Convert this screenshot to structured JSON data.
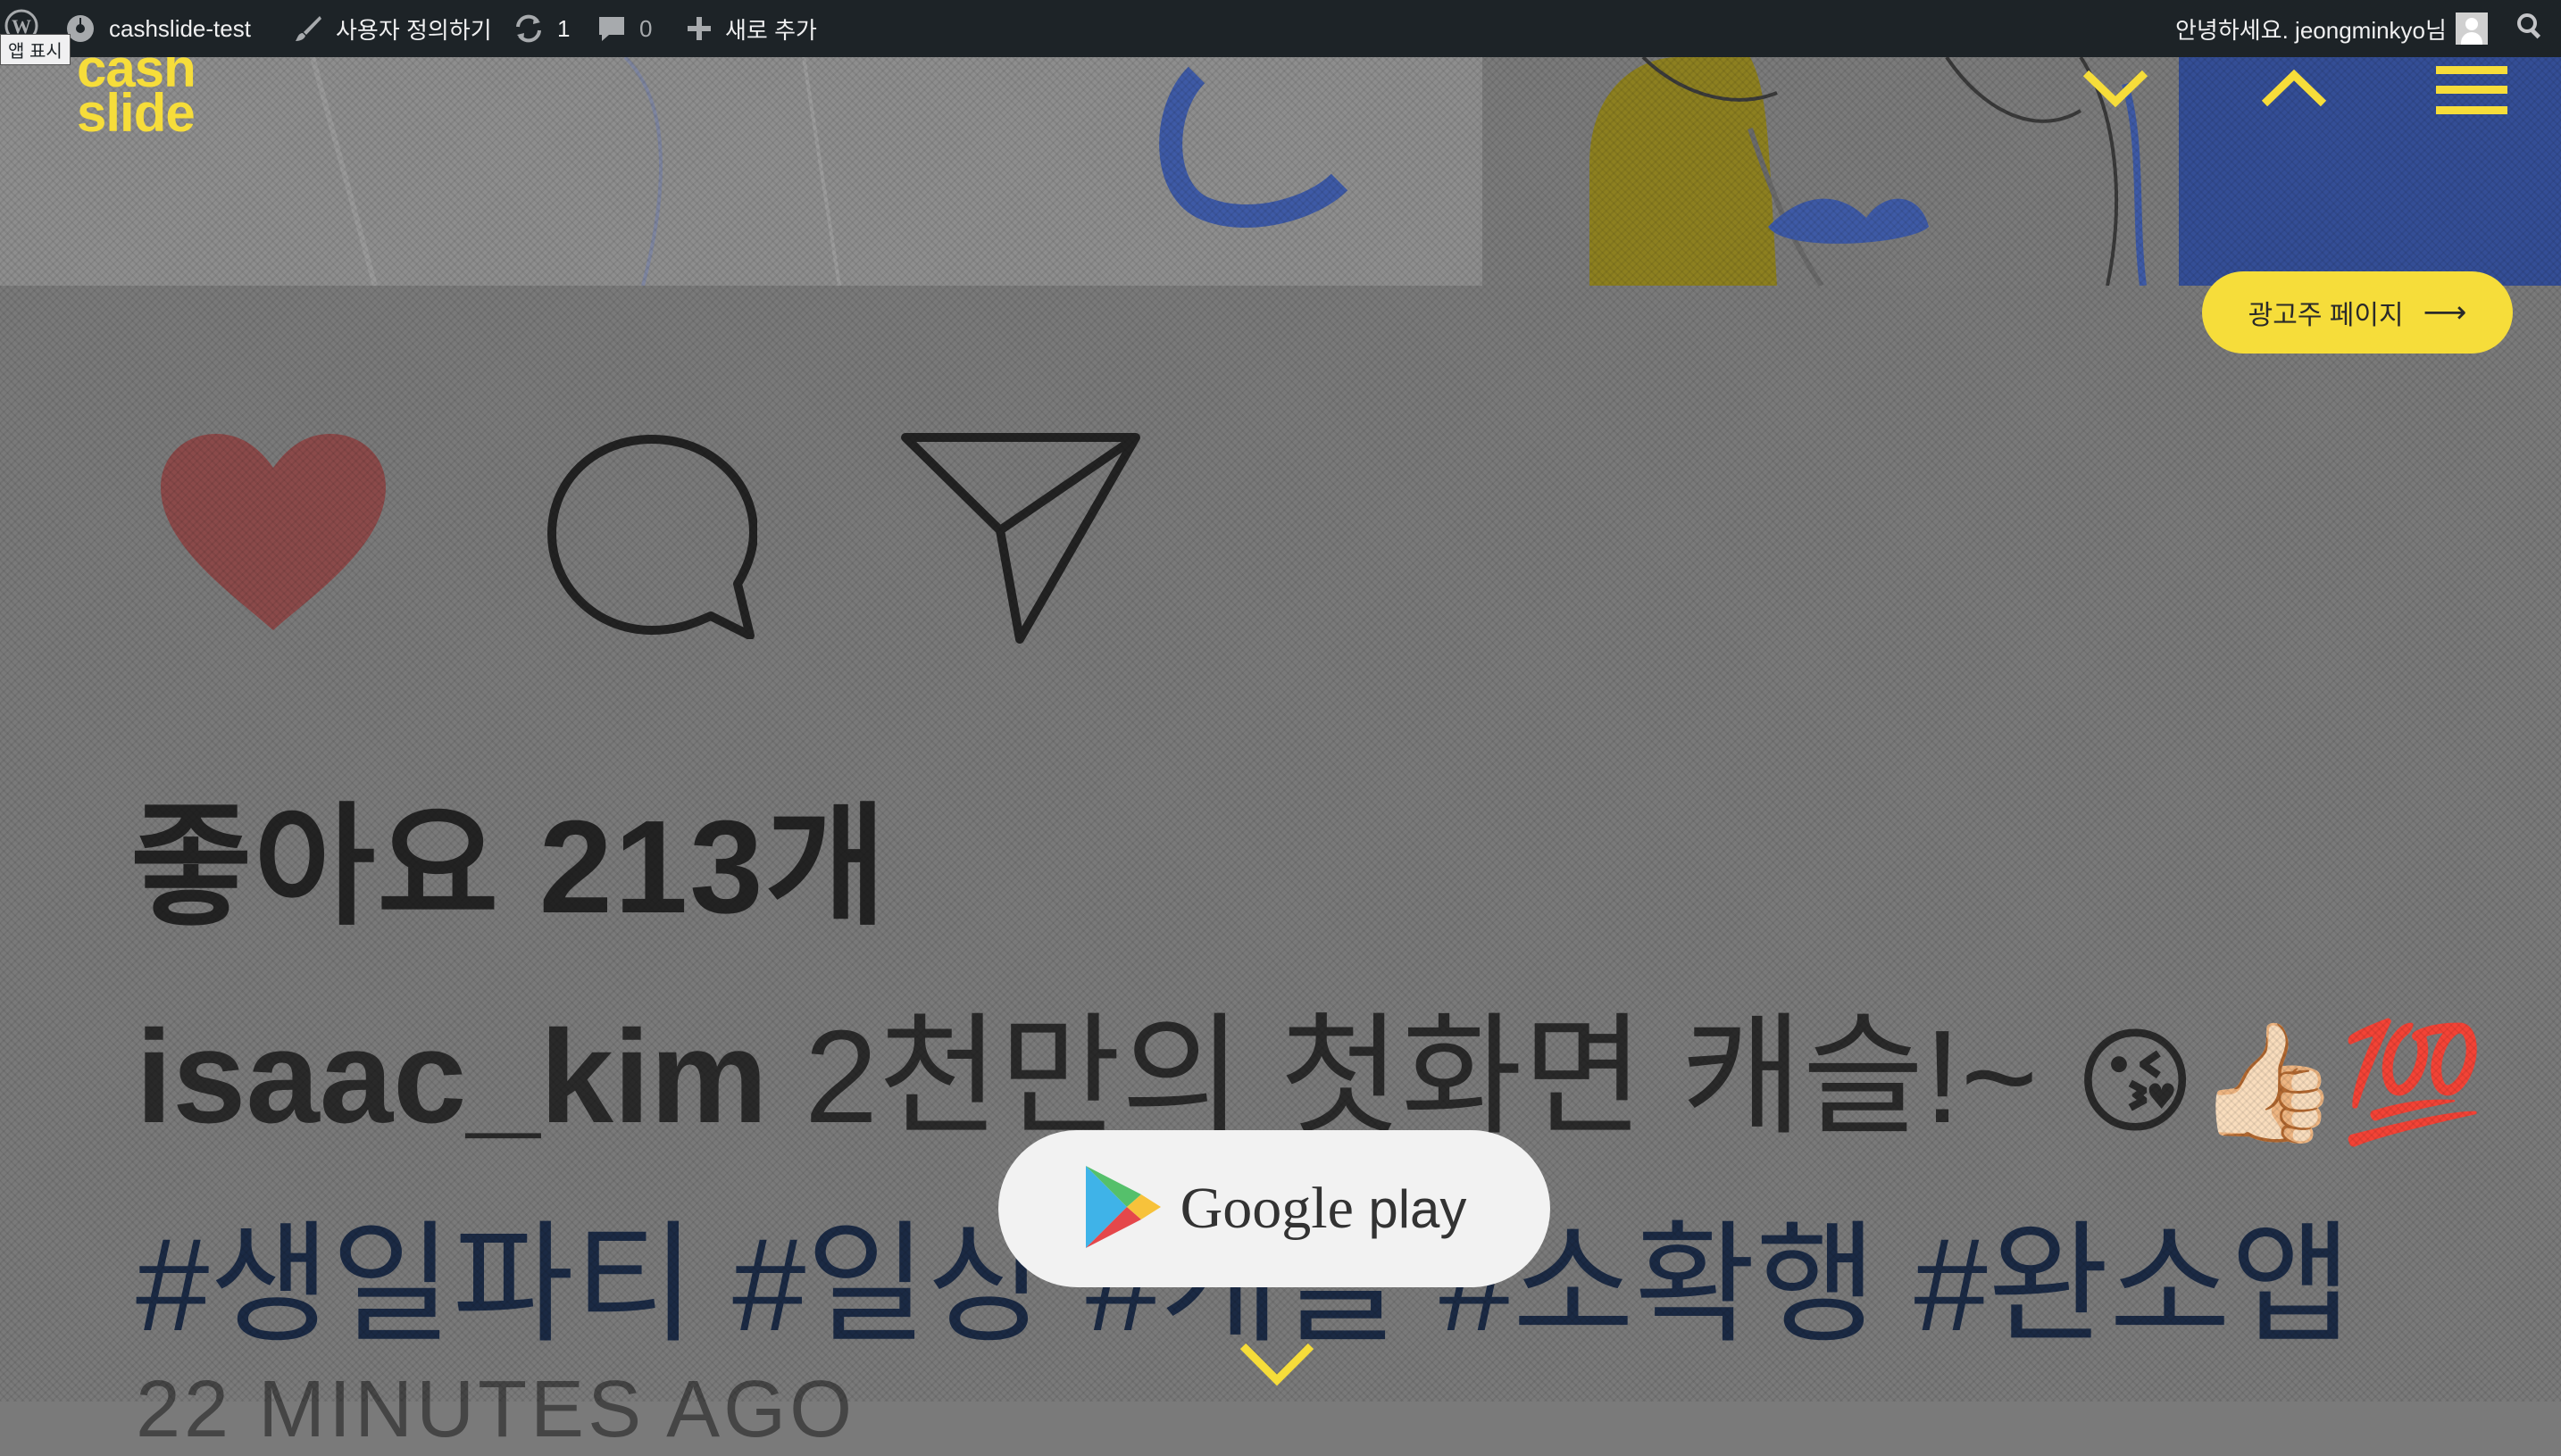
{
  "admin_bar": {
    "site_name": "cashslide-test",
    "customize_label": "사용자 정의하기",
    "updates_count": "1",
    "comments_count": "0",
    "new_label": "새로 추가",
    "greeting": "안녕하세요. jeongminkyo님",
    "screen_tag": "앱 표시"
  },
  "header": {
    "logo_line1": "cash",
    "logo_line2": "slide",
    "accent_color": "#f6dd3a"
  },
  "advertiser_button": {
    "label": "광고주 페이지",
    "arrow": "⟶"
  },
  "post": {
    "likes": "좋아요 213개",
    "username": "isaac_kim",
    "caption_text": " 2천만의 첫화면 캐슬!~ ",
    "emojis": "😘👍🏻💯",
    "hashtags": "#생일파티 #일상 #캐슬 #소확행 #완소앱",
    "time_ago": "22 MINUTES AGO"
  },
  "google_play": {
    "brand": "Google",
    "play": "play"
  },
  "icons": [
    "wordpress-icon",
    "dashboard-icon",
    "brush-icon",
    "update-icon",
    "comment-icon",
    "plus-icon",
    "avatar",
    "search-icon",
    "chevron-down-icon",
    "chevron-up-icon",
    "menu-icon",
    "heart-icon",
    "comment-bubble-icon",
    "send-icon",
    "google-play-icon"
  ]
}
